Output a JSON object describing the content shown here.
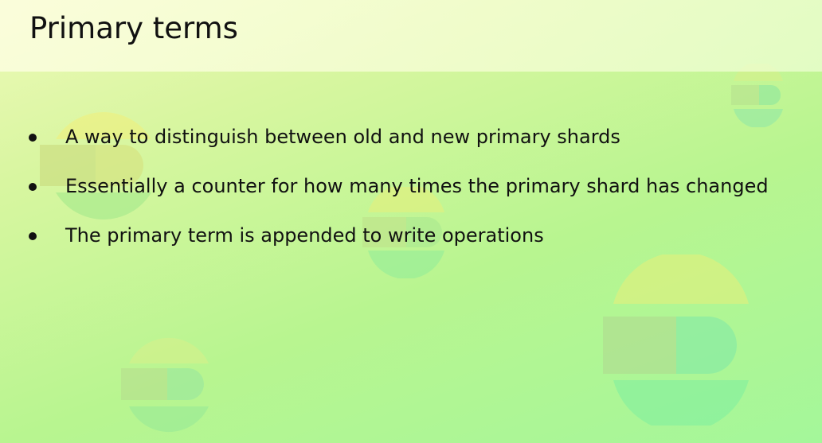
{
  "slide": {
    "title": "Primary terms",
    "bullets": [
      "A way to distinguish between old and new primary shards",
      "Essentially a counter for how many times the primary shard has changed",
      "The primary term is appended to write operations"
    ]
  },
  "colors": {
    "background_start": "#eef9b8",
    "background_end": "#a4f79a",
    "text": "#111111"
  }
}
